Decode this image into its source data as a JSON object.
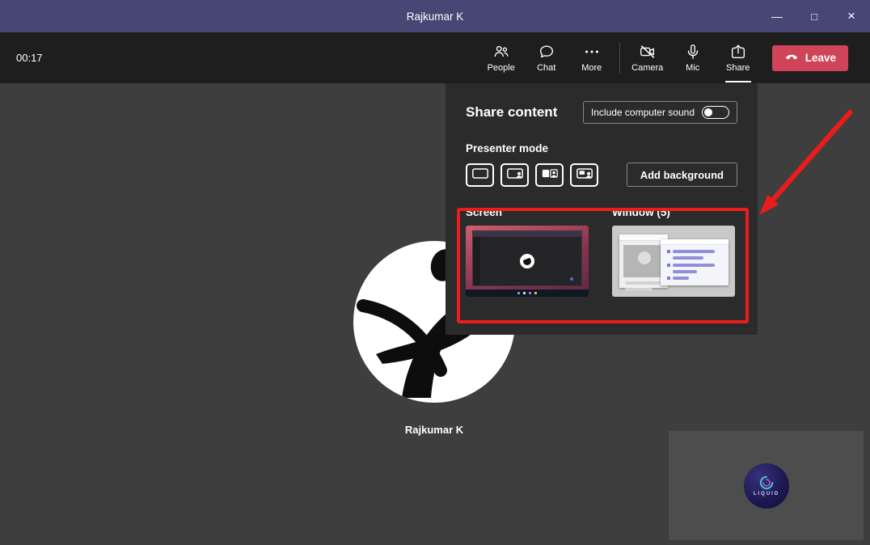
{
  "colors": {
    "titlebar": "#464775",
    "toolbar": "#1f1e1e",
    "stage": "#3f3e3e",
    "panel": "#2b2b2b",
    "leave_red": "#cf4458",
    "annotation_red": "#ea1c1c",
    "window_thumb_accent": "#8f90d8"
  },
  "titlebar": {
    "title": "Rajkumar K",
    "minimize_glyph": "—",
    "maximize_glyph": "□",
    "close_glyph": "×"
  },
  "toolbar": {
    "timer": "00:17",
    "buttons": [
      {
        "id": "people",
        "label": "People"
      },
      {
        "id": "chat",
        "label": "Chat"
      },
      {
        "id": "more",
        "label": "More"
      },
      {
        "id": "camera",
        "label": "Camera"
      },
      {
        "id": "mic",
        "label": "Mic"
      },
      {
        "id": "share",
        "label": "Share"
      }
    ],
    "leave": {
      "label": "Leave"
    }
  },
  "stage": {
    "participant_name": "Rajkumar K"
  },
  "share_panel": {
    "title": "Share content",
    "computer_sound": {
      "label": "Include computer sound",
      "enabled": false
    },
    "presenter_mode": {
      "label": "Presenter mode",
      "modes": [
        "content-only",
        "standout",
        "side-by-side",
        "reporter"
      ]
    },
    "add_background_label": "Add background",
    "sections": {
      "screen_label": "Screen",
      "window_label": "Window (5)"
    }
  },
  "selfview": {
    "logo_text": "LIQUID"
  }
}
